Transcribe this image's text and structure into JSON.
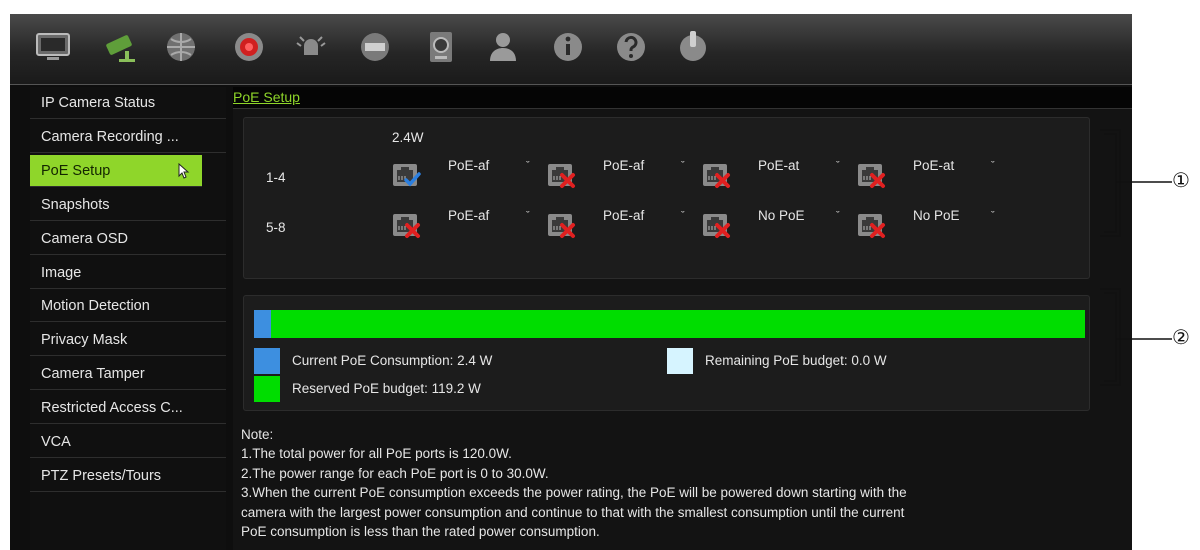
{
  "toolbar": {
    "icons": [
      "monitor-icon",
      "camera-icon",
      "network-icon",
      "record-icon",
      "alarm-icon",
      "device-icon",
      "storage-icon",
      "user-icon",
      "info-icon",
      "help-icon",
      "power-icon"
    ]
  },
  "sidebar": {
    "items": [
      {
        "label": "IP Camera Status"
      },
      {
        "label": "Camera Recording ..."
      },
      {
        "label": "PoE Setup",
        "active": true
      },
      {
        "label": "Snapshots"
      },
      {
        "label": "Camera OSD"
      },
      {
        "label": "Image"
      },
      {
        "label": "Motion Detection"
      },
      {
        "label": "Privacy Mask"
      },
      {
        "label": "Camera Tamper"
      },
      {
        "label": "Restricted Access C..."
      },
      {
        "label": "VCA"
      },
      {
        "label": "PTZ Presets/Tours"
      }
    ]
  },
  "breadcrumb": "PoE Setup",
  "ports": {
    "power_reading": "2.4W",
    "rows": [
      {
        "label": "1-4",
        "ports": [
          {
            "mode": "PoE-af",
            "status": "connected"
          },
          {
            "mode": "PoE-af",
            "status": "disconnected"
          },
          {
            "mode": "PoE-at",
            "status": "disconnected"
          },
          {
            "mode": "PoE-at",
            "status": "disconnected"
          }
        ]
      },
      {
        "label": "5-8",
        "ports": [
          {
            "mode": "PoE-af",
            "status": "disconnected"
          },
          {
            "mode": "PoE-af",
            "status": "disconnected"
          },
          {
            "mode": "No PoE",
            "status": "disconnected"
          },
          {
            "mode": "No PoE",
            "status": "disconnected"
          }
        ]
      }
    ]
  },
  "budget": {
    "total_w": 120.0,
    "current_w": 2.4,
    "reserved_w": 117.6,
    "remaining_w": 0.0,
    "current_label": "Current PoE Consumption: 2.4 W",
    "reserved_label": "Reserved PoE budget: 119.2 W",
    "remaining_label": "Remaining PoE budget: 0.0 W",
    "colors": {
      "current": "#3d8fe0",
      "reserved": "#00dd00",
      "remaining": "#d6f4ff"
    }
  },
  "note": {
    "title": "Note:",
    "lines": [
      "1.The total power for all PoE ports is 120.0W.",
      "2.The power range for each PoE port is 0 to 30.0W.",
      "3.When the current PoE consumption exceeds the power rating, the PoE will be powered down starting with the",
      "camera with the largest power consumption and continue to that with the smallest consumption until the current",
      "PoE consumption is less than the rated power consumption."
    ]
  },
  "callouts": [
    "①",
    "②"
  ]
}
